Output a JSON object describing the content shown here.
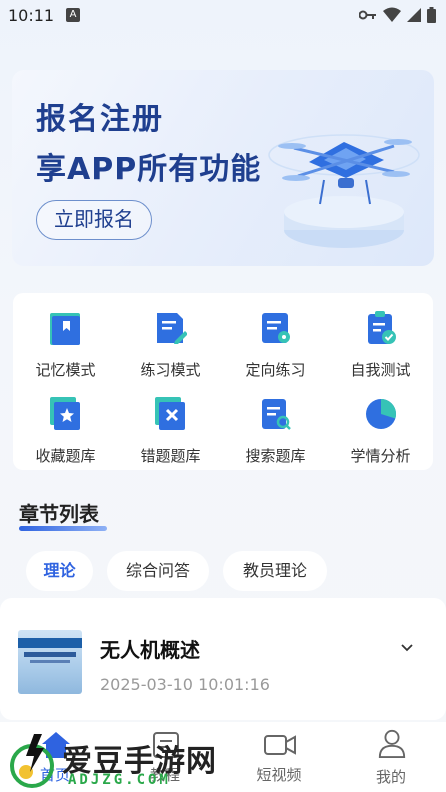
{
  "status_bar": {
    "time": "10:11",
    "indicator": "A"
  },
  "banner": {
    "line1": "报名注册",
    "line2": "享APP所有功能",
    "cta": "立即报名"
  },
  "quick_actions": [
    {
      "label": "记忆模式",
      "icon": "book-icon",
      "color": "#2f6fe0"
    },
    {
      "label": "练习模式",
      "icon": "doc-edit-icon",
      "color": "#2f6fe0"
    },
    {
      "label": "定向练习",
      "icon": "doc-location-icon",
      "color": "#2f6fe0"
    },
    {
      "label": "自我测试",
      "icon": "clipboard-check-icon",
      "color": "#2f6fe0"
    },
    {
      "label": "收藏题库",
      "icon": "star-doc-icon",
      "color": "#2f6fe0"
    },
    {
      "label": "错题题库",
      "icon": "x-doc-icon",
      "color": "#2f6fe0"
    },
    {
      "label": "搜索题库",
      "icon": "search-doc-icon",
      "color": "#2f6fe0"
    },
    {
      "label": "学情分析",
      "icon": "pie-chart-icon",
      "color": "#2f6fe0"
    }
  ],
  "section": {
    "title": "章节列表"
  },
  "tabs": [
    {
      "label": "理论",
      "active": true
    },
    {
      "label": "综合问答",
      "active": false
    },
    {
      "label": "教员理论",
      "active": false
    }
  ],
  "chapter": {
    "title": "无人机概述",
    "time": "2025-03-10 10:01:16"
  },
  "nav": [
    {
      "label": "首页",
      "icon": "home-icon",
      "active": true
    },
    {
      "label": "教程",
      "icon": "tutorial-icon",
      "active": false
    },
    {
      "label": "短视频",
      "icon": "video-icon",
      "active": false
    },
    {
      "label": "我的",
      "icon": "user-icon",
      "active": false
    }
  ],
  "watermark": {
    "text": "爱豆手游网",
    "sub": "ADJZG.COM"
  },
  "colors": {
    "accent": "#2f63e0",
    "banner_text": "#1f3f8f",
    "icon_teal": "#36c3b6"
  }
}
